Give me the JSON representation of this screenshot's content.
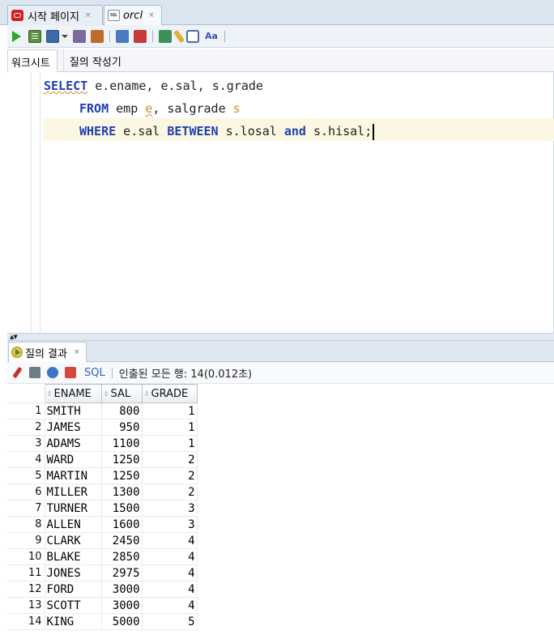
{
  "tabs": [
    {
      "label": "시작 페이지",
      "close": "×"
    },
    {
      "label": "orcl",
      "close": "×"
    }
  ],
  "toolbar_icons": [
    "run-statement-icon",
    "run-script-icon",
    "commit-icon",
    "dropdown-icon",
    "explain-plan-icon",
    "autotrace-icon",
    "rollback-icon",
    "cancel-icon",
    "sql-tuning-icon",
    "clear-icon",
    "sql-history-icon",
    "format-icon"
  ],
  "editor_tabs": {
    "worksheet": "워크시트",
    "query_builder": "질의 작성기"
  },
  "code": {
    "l1_kw": "SELECT",
    "l1_rest": " e.ename, e.sal, s.grade",
    "l2_kw": "FROM",
    "l2_table1": " emp ",
    "l2_alias1": "e",
    "l2_comma": ", salgrade ",
    "l2_alias2": "s",
    "l3_kw1": "WHERE",
    "l3_p1": " e.sal ",
    "l3_kw2": "BETWEEN",
    "l3_p2": " s.losal ",
    "l3_kw3": "and",
    "l3_p3": " s.hisal;"
  },
  "results": {
    "tab_label": "질의 결과",
    "tab_close": "×",
    "sql_label": "SQL",
    "status": "인출된 모든 행: 14(0.012초)",
    "columns": [
      "ENAME",
      "SAL",
      "GRADE"
    ],
    "rows": [
      {
        "n": "1",
        "ename": "SMITH",
        "sal": "800",
        "grade": "1"
      },
      {
        "n": "2",
        "ename": "JAMES",
        "sal": "950",
        "grade": "1"
      },
      {
        "n": "3",
        "ename": "ADAMS",
        "sal": "1100",
        "grade": "1"
      },
      {
        "n": "4",
        "ename": "WARD",
        "sal": "1250",
        "grade": "2"
      },
      {
        "n": "5",
        "ename": "MARTIN",
        "sal": "1250",
        "grade": "2"
      },
      {
        "n": "6",
        "ename": "MILLER",
        "sal": "1300",
        "grade": "2"
      },
      {
        "n": "7",
        "ename": "TURNER",
        "sal": "1500",
        "grade": "3"
      },
      {
        "n": "8",
        "ename": "ALLEN",
        "sal": "1600",
        "grade": "3"
      },
      {
        "n": "9",
        "ename": "CLARK",
        "sal": "2450",
        "grade": "4"
      },
      {
        "n": "10",
        "ename": "BLAKE",
        "sal": "2850",
        "grade": "4"
      },
      {
        "n": "11",
        "ename": "JONES",
        "sal": "2975",
        "grade": "4"
      },
      {
        "n": "12",
        "ename": "FORD",
        "sal": "3000",
        "grade": "4"
      },
      {
        "n": "13",
        "ename": "SCOTT",
        "sal": "3000",
        "grade": "4"
      },
      {
        "n": "14",
        "ename": "KING",
        "sal": "5000",
        "grade": "5"
      }
    ]
  },
  "colors": {
    "keyword": "#1f3fb2",
    "alias": "#d28a26",
    "current_line": "#fbf7e3"
  }
}
